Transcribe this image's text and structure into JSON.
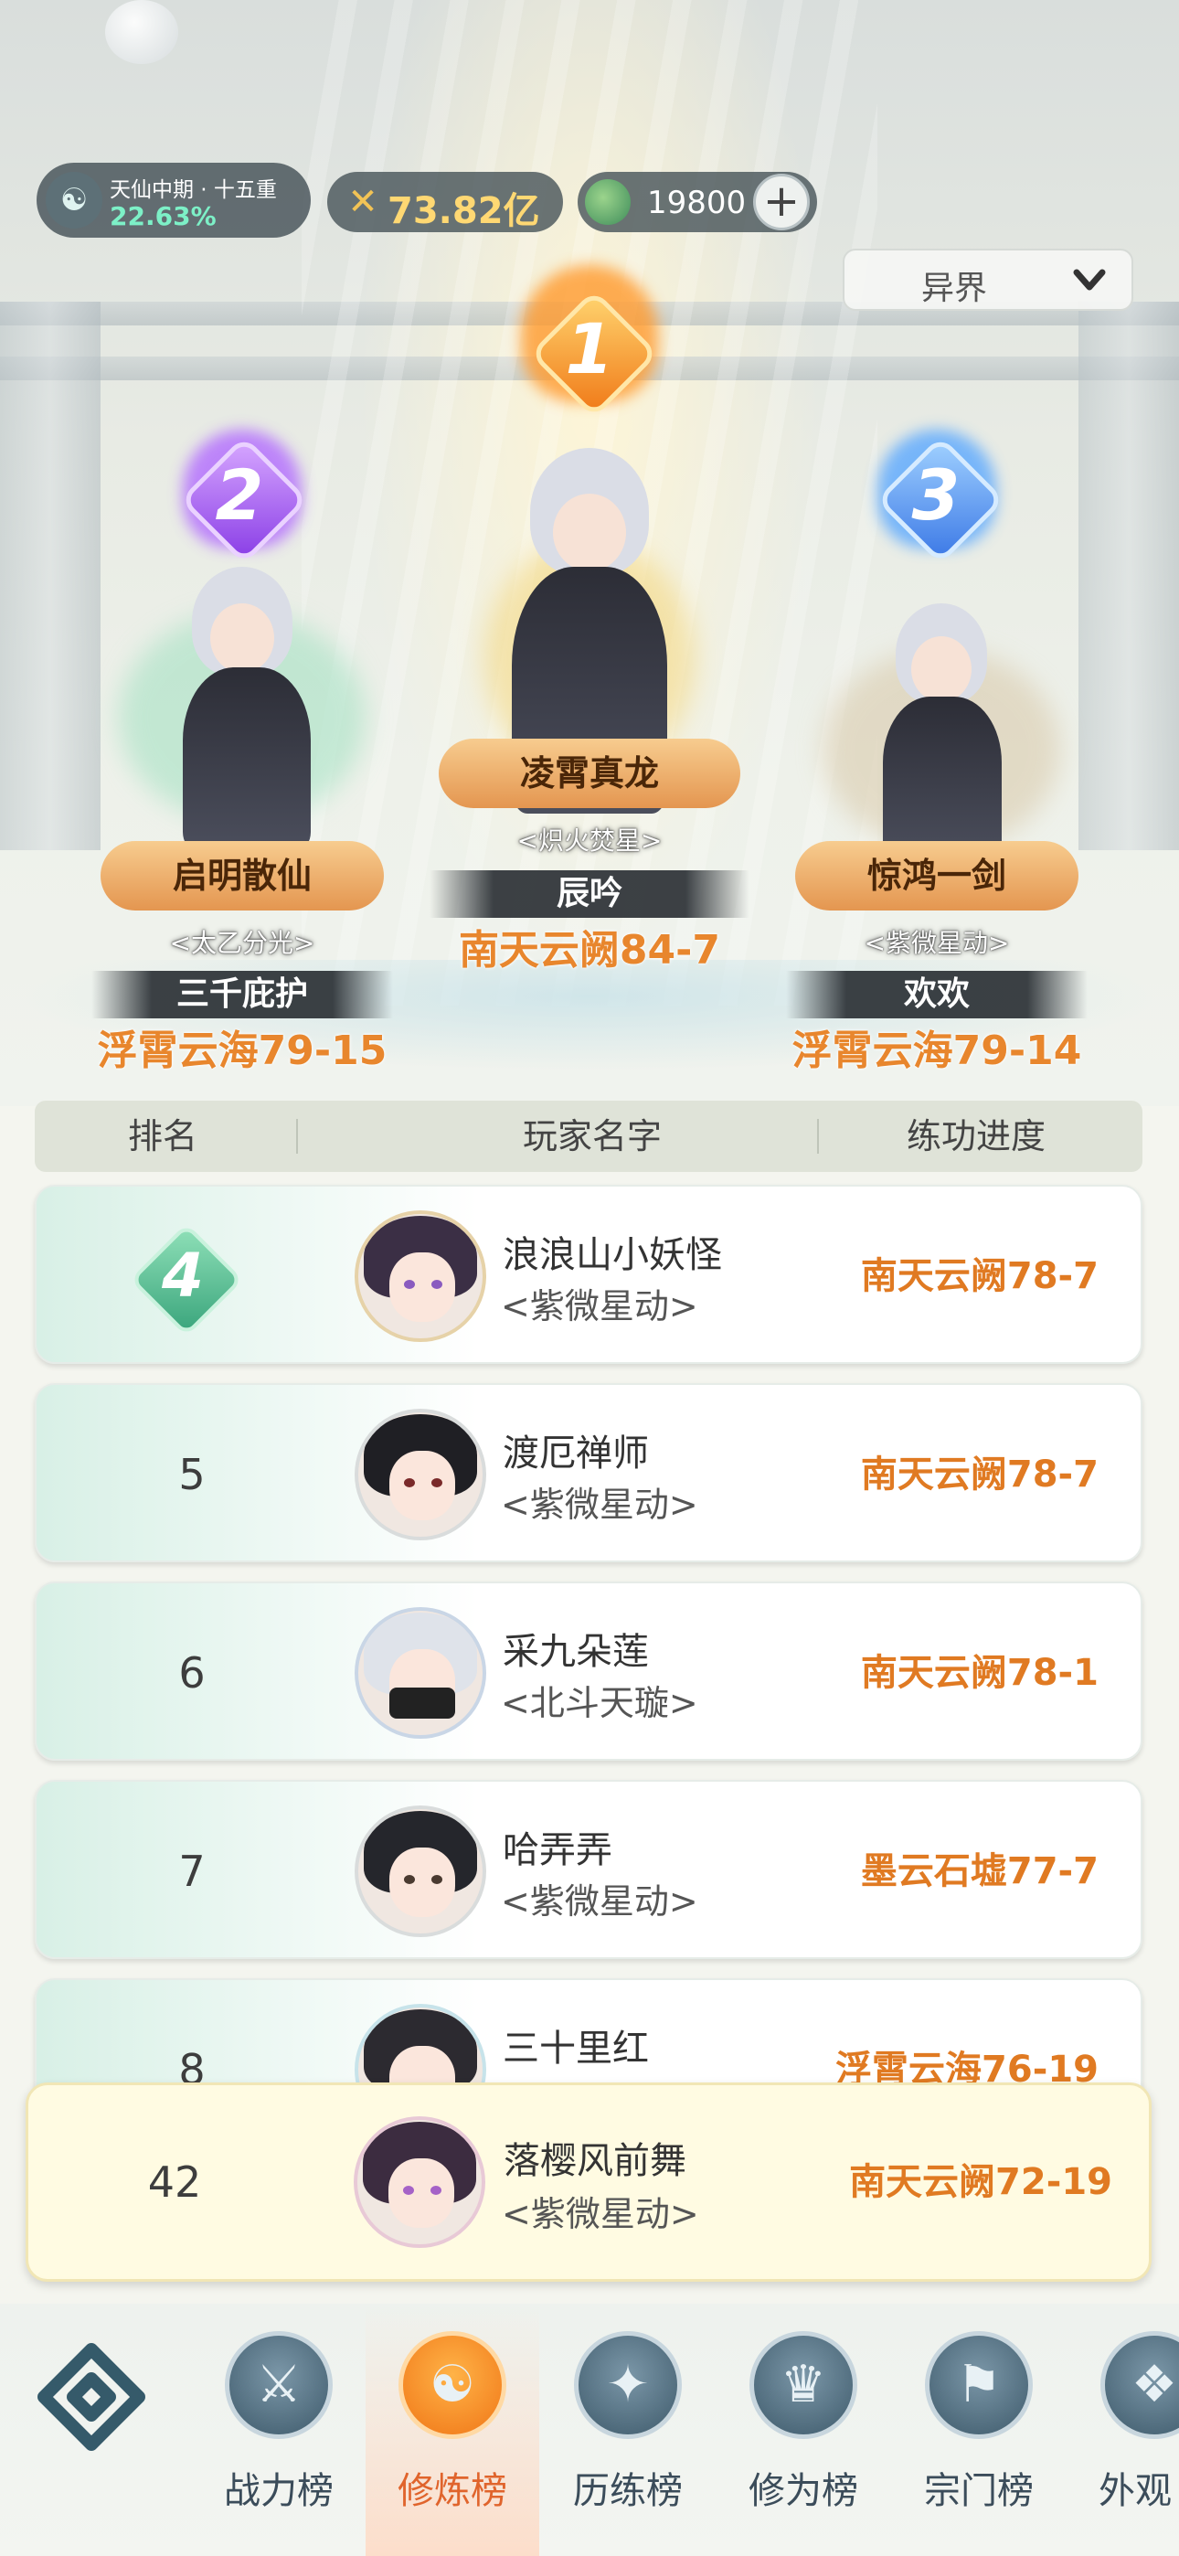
{
  "status": {
    "realm_title": "天仙中期 · 十五重",
    "realm_percent": "22.63%",
    "combat_power": "73.82亿",
    "spirit_stones": "19800"
  },
  "world_selector": {
    "selected": "异界"
  },
  "podium": [
    {
      "rank": "1",
      "title": "凌霄真龙",
      "guild": "<炽火焚星>",
      "name": "辰吟",
      "progress": "南天云阙84-7"
    },
    {
      "rank": "2",
      "title": "启明散仙",
      "guild": "<太乙分光>",
      "name": "三千庇护",
      "progress": "浮霄云海79-15"
    },
    {
      "rank": "3",
      "title": "惊鸿一剑",
      "guild": "<紫微星动>",
      "name": "欢欢",
      "progress": "浮霄云海79-14"
    }
  ],
  "table": {
    "headers": {
      "rank": "排名",
      "player": "玩家名字",
      "progress": "练功进度"
    },
    "rows": [
      {
        "rank": "4",
        "name": "浪浪山小妖怪",
        "guild": "<紫微星动>",
        "progress": "南天云阙78-7"
      },
      {
        "rank": "5",
        "name": "渡厄禅师",
        "guild": "<紫微星动>",
        "progress": "南天云阙78-7"
      },
      {
        "rank": "6",
        "name": "采九朵莲",
        "guild": "<北斗天璇>",
        "progress": "南天云阙78-1"
      },
      {
        "rank": "7",
        "name": "哈弄弄",
        "guild": "<紫微星动>",
        "progress": "墨云石墟77-7"
      },
      {
        "rank": "8",
        "name": "三十里红",
        "guild": "",
        "progress": "浮霄云海76-19"
      }
    ]
  },
  "my_rank": {
    "rank": "42",
    "name": "落樱风前舞",
    "guild": "<紫微星动>",
    "progress": "南天云阙72-19"
  },
  "nav": {
    "items": [
      {
        "label": "战力榜",
        "icon": "crossed-swords-icon"
      },
      {
        "label": "修炼榜",
        "icon": "yin-yang-icon",
        "active": true
      },
      {
        "label": "历练榜",
        "icon": "star-compass-icon"
      },
      {
        "label": "修为榜",
        "icon": "immortal-hat-icon"
      },
      {
        "label": "宗门榜",
        "icon": "banner-icon"
      },
      {
        "label": "外观",
        "icon": "outfit-icon"
      }
    ]
  },
  "colors": {
    "progress_orange": "#e07a22",
    "active_tab": "#f07617",
    "realm_percent_green": "#7df0c7",
    "my_row_bg": "#fffbe2"
  }
}
